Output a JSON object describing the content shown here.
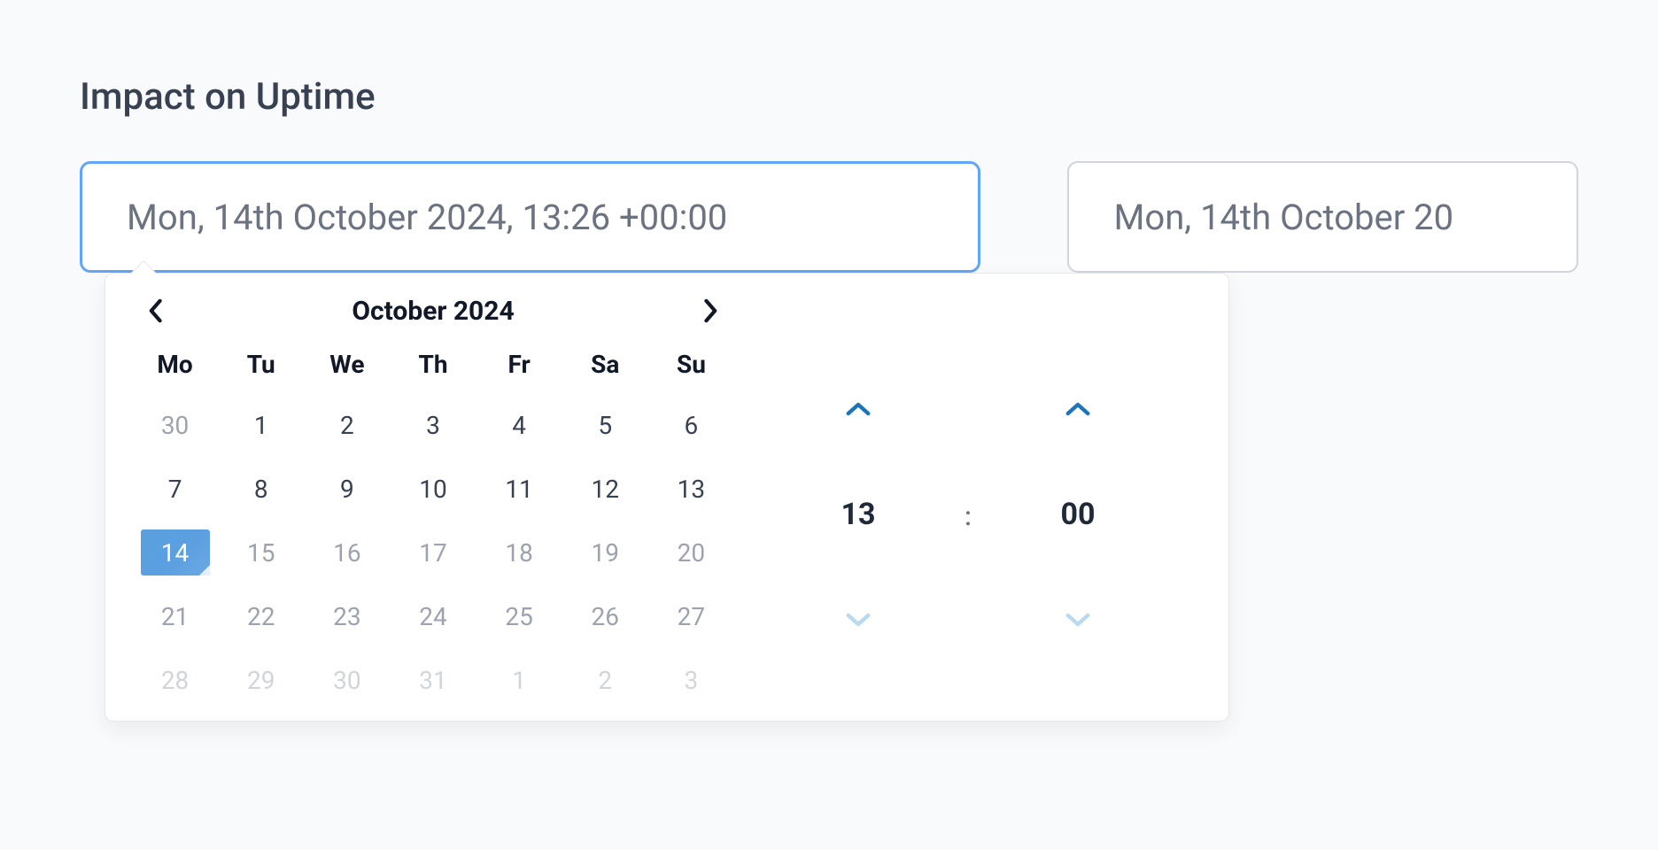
{
  "title": "Impact on Uptime",
  "inputs": {
    "start": "Mon, 14th October 2024, 13:26 +00:00",
    "end": "Mon, 14th October 20"
  },
  "calendar": {
    "month_label": "October 2024",
    "weekdays": [
      "Mo",
      "Tu",
      "We",
      "Th",
      "Fr",
      "Sa",
      "Su"
    ],
    "days": [
      {
        "n": "30",
        "cls": "outside"
      },
      {
        "n": "1",
        "cls": ""
      },
      {
        "n": "2",
        "cls": ""
      },
      {
        "n": "3",
        "cls": ""
      },
      {
        "n": "4",
        "cls": ""
      },
      {
        "n": "5",
        "cls": ""
      },
      {
        "n": "6",
        "cls": ""
      },
      {
        "n": "7",
        "cls": ""
      },
      {
        "n": "8",
        "cls": ""
      },
      {
        "n": "9",
        "cls": ""
      },
      {
        "n": "10",
        "cls": ""
      },
      {
        "n": "11",
        "cls": ""
      },
      {
        "n": "12",
        "cls": ""
      },
      {
        "n": "13",
        "cls": ""
      },
      {
        "n": "14",
        "cls": "selected"
      },
      {
        "n": "15",
        "cls": "faded"
      },
      {
        "n": "16",
        "cls": "faded"
      },
      {
        "n": "17",
        "cls": "faded"
      },
      {
        "n": "18",
        "cls": "faded"
      },
      {
        "n": "19",
        "cls": "faded"
      },
      {
        "n": "20",
        "cls": "faded"
      },
      {
        "n": "21",
        "cls": "faded"
      },
      {
        "n": "22",
        "cls": "faded"
      },
      {
        "n": "23",
        "cls": "faded"
      },
      {
        "n": "24",
        "cls": "faded"
      },
      {
        "n": "25",
        "cls": "faded"
      },
      {
        "n": "26",
        "cls": "faded"
      },
      {
        "n": "27",
        "cls": "faded"
      },
      {
        "n": "28",
        "cls": "ghost"
      },
      {
        "n": "29",
        "cls": "ghost"
      },
      {
        "n": "30",
        "cls": "ghost"
      },
      {
        "n": "31",
        "cls": "ghost"
      },
      {
        "n": "1",
        "cls": "ghost"
      },
      {
        "n": "2",
        "cls": "ghost"
      },
      {
        "n": "3",
        "cls": "ghost"
      }
    ]
  },
  "time": {
    "hour": "13",
    "separator": ":",
    "minute": "00"
  },
  "colors": {
    "accent": "#3b82f6",
    "selected_bg": "#5aa1de",
    "arrow_disabled": "#c6dff3"
  }
}
